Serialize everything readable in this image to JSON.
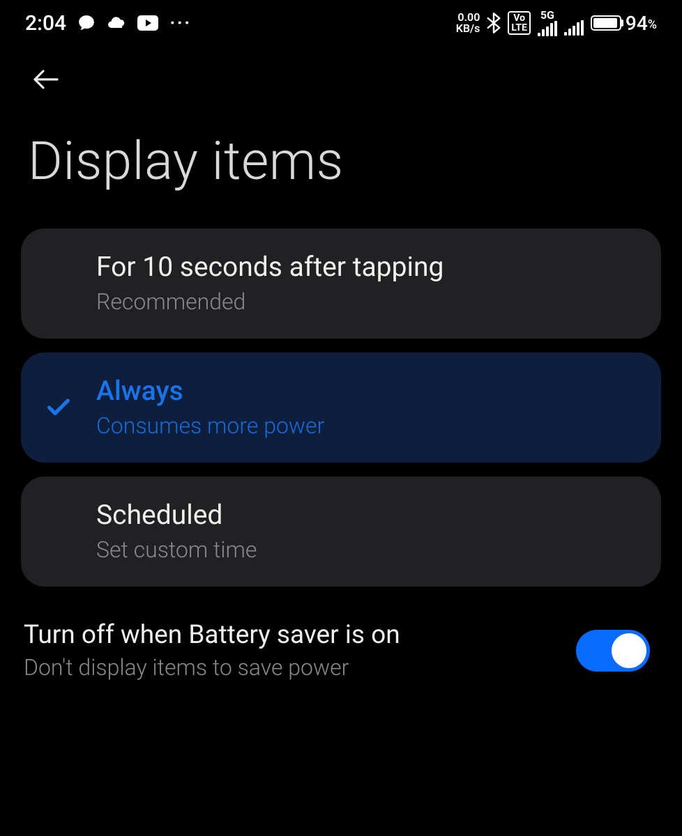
{
  "status": {
    "time": "2:04",
    "net_speed_top": "0.00",
    "net_speed_unit": "KB/s",
    "volte": "Vo\nLTE",
    "net_type": "5G",
    "battery_pct": "94",
    "battery_fill_pct": 94,
    "dots": "···"
  },
  "page": {
    "title": "Display items"
  },
  "options": [
    {
      "title": "For 10 seconds after tapping",
      "sub": "Recommended",
      "selected": false
    },
    {
      "title": "Always",
      "sub": "Consumes more power",
      "selected": true
    },
    {
      "title": "Scheduled",
      "sub": "Set custom time",
      "selected": false
    }
  ],
  "battery_saver": {
    "title": "Turn off when Battery saver is on",
    "sub": "Don't display items to save power",
    "enabled": true
  }
}
